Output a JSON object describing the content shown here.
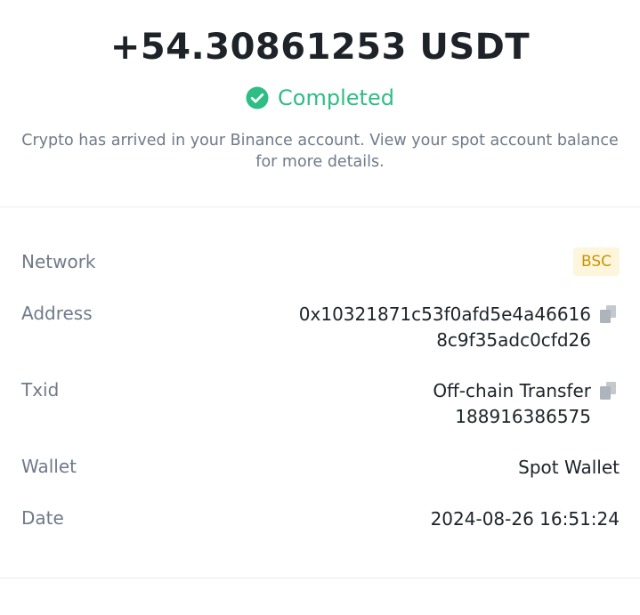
{
  "header": {
    "amount": "+54.30861253 USDT",
    "status": "Completed",
    "description": "Crypto has arrived in your Binance account. View your spot account balance for more details."
  },
  "details": {
    "network": {
      "label": "Network",
      "value": "BSC"
    },
    "address": {
      "label": "Address",
      "line1": "0x10321871c53f0afd5e4a46616",
      "line2": "8c9f35adc0cfd26"
    },
    "txid": {
      "label": "Txid",
      "line1": "Off-chain Transfer",
      "line2": "188916386575"
    },
    "wallet": {
      "label": "Wallet",
      "value": "Spot Wallet"
    },
    "date": {
      "label": "Date",
      "value": "2024-08-26 16:51:24"
    }
  },
  "colors": {
    "success": "#2ebd85",
    "badge_bg": "#fdf6dc",
    "badge_text": "#c99400",
    "muted_text": "#707a8a",
    "primary_text": "#1e2329"
  },
  "icons": {
    "status": "check-circle-icon",
    "copy": "copy-icon"
  }
}
